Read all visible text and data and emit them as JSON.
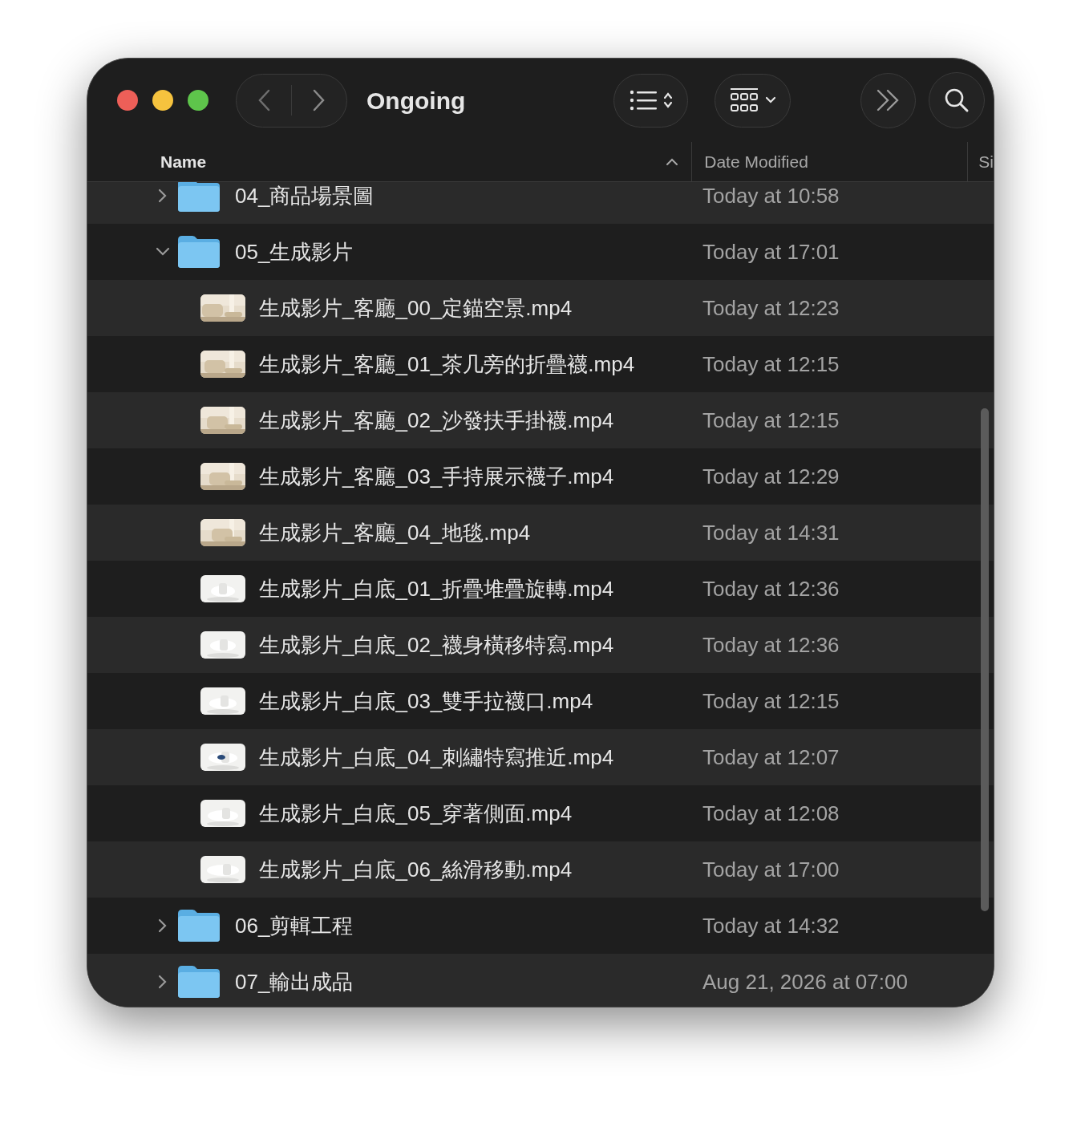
{
  "window": {
    "title": "Ongoing"
  },
  "columns": [
    {
      "label": "Name",
      "sorted": true
    },
    {
      "label": "Date Modified",
      "sorted": false
    },
    {
      "label": "Si",
      "sorted": false
    }
  ],
  "items": [
    {
      "kind": "folder",
      "name": "04_商品場景圖",
      "date": "Today at 10:58",
      "expanded": false
    },
    {
      "kind": "folder",
      "name": "05_生成影片",
      "date": "Today at 17:01",
      "expanded": true,
      "children": [
        {
          "kind": "video",
          "name": "生成影片_客廳_00_定錨空景.mp4",
          "date": "Today at 12:23"
        },
        {
          "kind": "video",
          "name": "生成影片_客廳_01_茶几旁的折疊襪.mp4",
          "date": "Today at 12:15"
        },
        {
          "kind": "video",
          "name": "生成影片_客廳_02_沙發扶手掛襪.mp4",
          "date": "Today at 12:15"
        },
        {
          "kind": "video",
          "name": "生成影片_客廳_03_手持展示襪子.mp4",
          "date": "Today at 12:29"
        },
        {
          "kind": "video",
          "name": "生成影片_客廳_04_地毯.mp4",
          "date": "Today at 14:31"
        },
        {
          "kind": "video",
          "name": "生成影片_白底_01_折疊堆疊旋轉.mp4",
          "date": "Today at 12:36"
        },
        {
          "kind": "video",
          "name": "生成影片_白底_02_襪身橫移特寫.mp4",
          "date": "Today at 12:36"
        },
        {
          "kind": "video",
          "name": "生成影片_白底_03_雙手拉襪口.mp4",
          "date": "Today at 12:15"
        },
        {
          "kind": "video",
          "name": "生成影片_白底_04_刺繡特寫推近.mp4",
          "date": "Today at 12:07"
        },
        {
          "kind": "video",
          "name": "生成影片_白底_05_穿著側面.mp4",
          "date": "Today at 12:08"
        },
        {
          "kind": "video",
          "name": "生成影片_白底_06_絲滑移動.mp4",
          "date": "Today at 17:00"
        }
      ]
    },
    {
      "kind": "folder",
      "name": "06_剪輯工程",
      "date": "Today at 14:32",
      "expanded": false
    },
    {
      "kind": "folder",
      "name": "07_輸出成品",
      "date": "Aug 21, 2026 at 07:00",
      "expanded": false
    }
  ]
}
